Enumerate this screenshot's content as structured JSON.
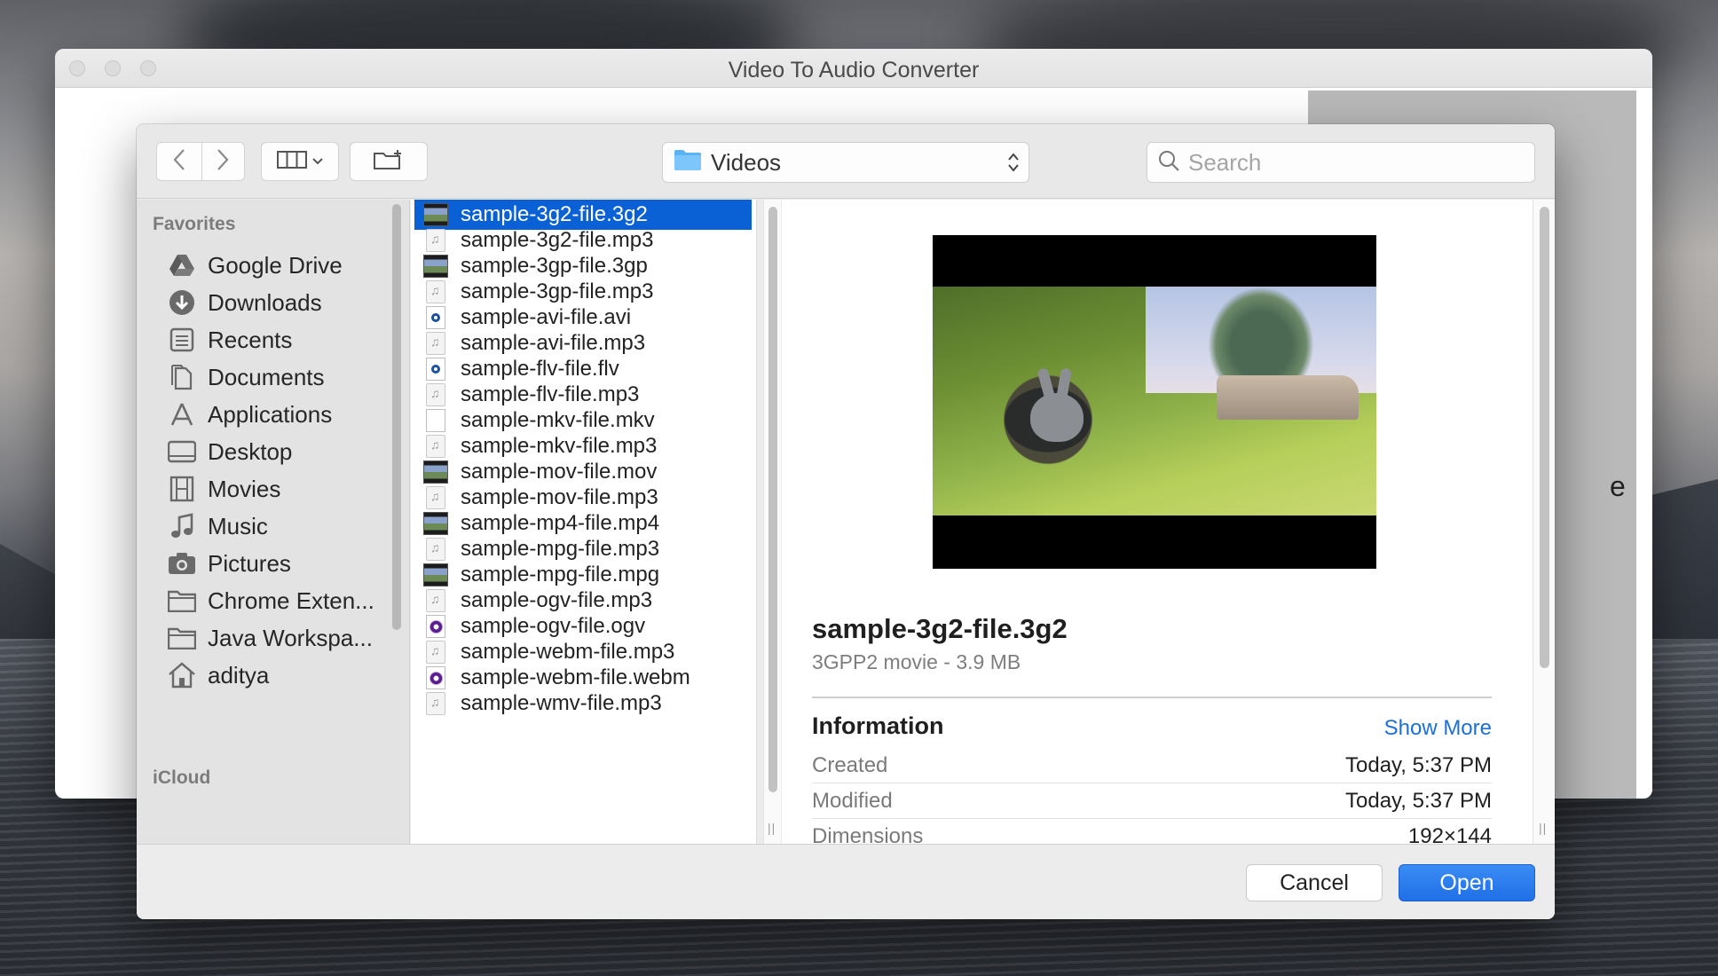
{
  "app": {
    "title": "Video To Audio Converter",
    "partial_label": "e"
  },
  "dialog": {
    "location": "Videos",
    "search_placeholder": "Search",
    "sidebar": {
      "favorites_header": "Favorites",
      "items": [
        {
          "label": "Google Drive",
          "icon": "google-drive-icon"
        },
        {
          "label": "Downloads",
          "icon": "downloads-icon"
        },
        {
          "label": "Recents",
          "icon": "recents-icon"
        },
        {
          "label": "Documents",
          "icon": "documents-icon"
        },
        {
          "label": "Applications",
          "icon": "applications-icon"
        },
        {
          "label": "Desktop",
          "icon": "desktop-icon"
        },
        {
          "label": "Movies",
          "icon": "movies-icon"
        },
        {
          "label": "Music",
          "icon": "music-icon"
        },
        {
          "label": "Pictures",
          "icon": "pictures-icon"
        },
        {
          "label": "Chrome Exten...",
          "icon": "folder-icon"
        },
        {
          "label": "Java Workspa...",
          "icon": "folder-icon"
        },
        {
          "label": "aditya",
          "icon": "home-icon"
        }
      ],
      "icloud_header": "iCloud"
    },
    "files": [
      {
        "name": "sample-3g2-file.3g2",
        "type": "video",
        "selected": true
      },
      {
        "name": "sample-3g2-file.mp3",
        "type": "audio"
      },
      {
        "name": "sample-3gp-file.3gp",
        "type": "video"
      },
      {
        "name": "sample-3gp-file.mp3",
        "type": "audio"
      },
      {
        "name": "sample-avi-file.avi",
        "type": "qt"
      },
      {
        "name": "sample-avi-file.mp3",
        "type": "audio"
      },
      {
        "name": "sample-flv-file.flv",
        "type": "qt"
      },
      {
        "name": "sample-flv-file.mp3",
        "type": "audio"
      },
      {
        "name": "sample-mkv-file.mkv",
        "type": "blank"
      },
      {
        "name": "sample-mkv-file.mp3",
        "type": "audio"
      },
      {
        "name": "sample-mov-file.mov",
        "type": "video"
      },
      {
        "name": "sample-mov-file.mp3",
        "type": "audio"
      },
      {
        "name": "sample-mp4-file.mp4",
        "type": "video"
      },
      {
        "name": "sample-mpg-file.mp3",
        "type": "audio"
      },
      {
        "name": "sample-mpg-file.mpg",
        "type": "video"
      },
      {
        "name": "sample-ogv-file.mp3",
        "type": "audio"
      },
      {
        "name": "sample-ogv-file.ogv",
        "type": "ogv"
      },
      {
        "name": "sample-webm-file.mp3",
        "type": "audio"
      },
      {
        "name": "sample-webm-file.webm",
        "type": "ogv"
      },
      {
        "name": "sample-wmv-file.mp3",
        "type": "audio"
      }
    ],
    "preview": {
      "file_name": "sample-3g2-file.3g2",
      "kind": "3GPP2 movie - 3.9 MB",
      "info_header": "Information",
      "show_more": "Show More",
      "rows": [
        {
          "key": "Created",
          "value": "Today, 5:37 PM"
        },
        {
          "key": "Modified",
          "value": "Today, 5:37 PM"
        },
        {
          "key": "Dimensions",
          "value": "192×144"
        }
      ]
    },
    "buttons": {
      "cancel": "Cancel",
      "open": "Open"
    }
  },
  "colors": {
    "accent": "#1f6fe6",
    "selection": "#0a61d6",
    "link": "#1a6fd8"
  }
}
